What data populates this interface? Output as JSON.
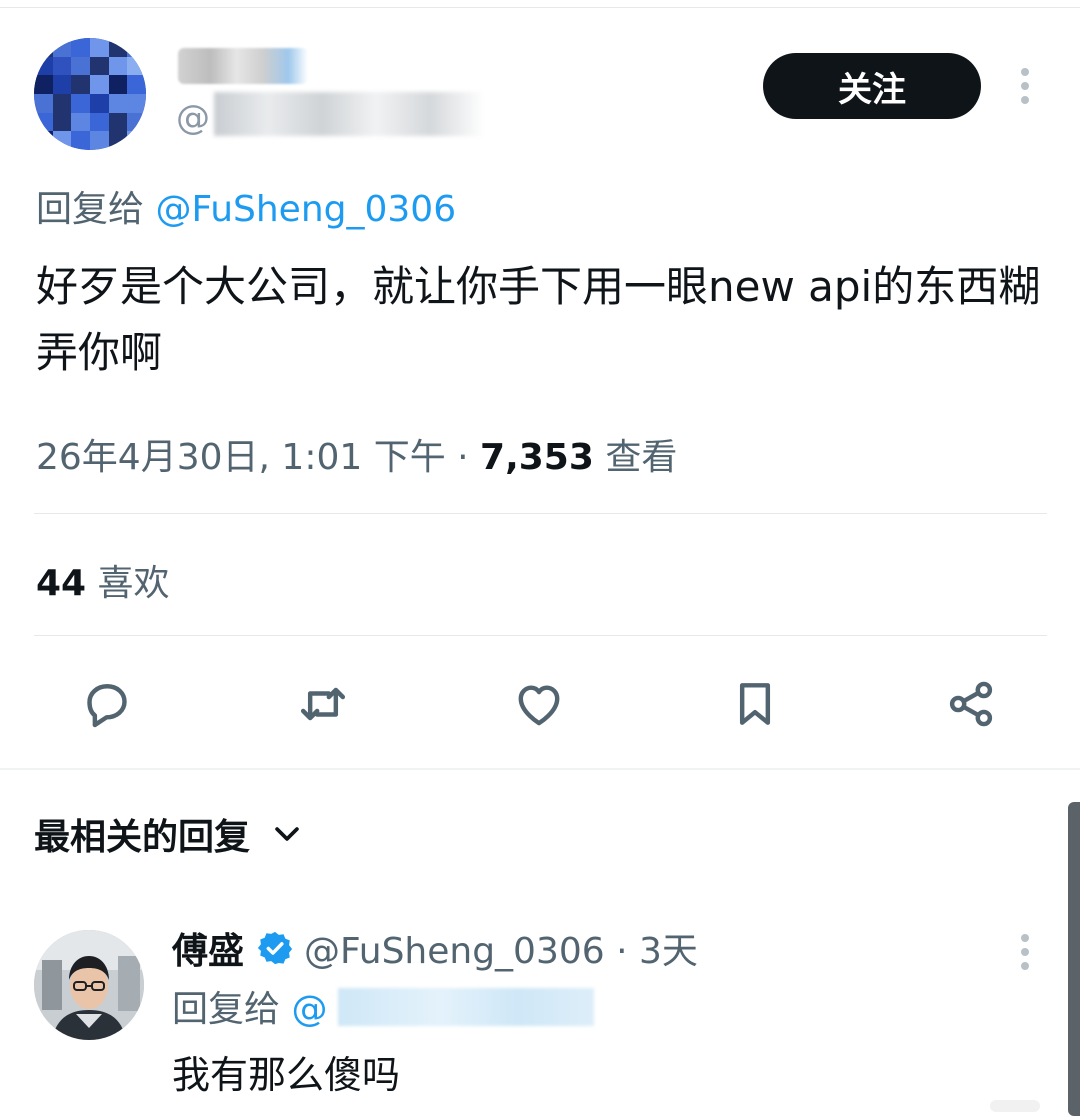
{
  "tweet": {
    "handle_at": "@",
    "follow_label": "关注",
    "reply_to_prefix": "回复给 ",
    "reply_to_handle": "@FuSheng_0306",
    "text": "好歹是个大公司，就让你手下用一眼new api的东西糊弄你啊",
    "timestamp": "26年4月30日, 1:01 下午 · ",
    "views_count": "7,353",
    "views_label": " 查看",
    "likes_count": "44",
    "likes_label": " 喜欢"
  },
  "actions": [
    {
      "name": "reply",
      "icon": "reply-icon"
    },
    {
      "name": "retweet",
      "icon": "retweet-icon"
    },
    {
      "name": "like",
      "icon": "heart-icon"
    },
    {
      "name": "bookmark",
      "icon": "bookmark-icon"
    },
    {
      "name": "share",
      "icon": "share-icon"
    }
  ],
  "replies_section": {
    "sort_label": "最相关的回复",
    "sort_icon": "chevron-down-icon"
  },
  "reply": {
    "name": "傅盛",
    "handle_time": "@FuSheng_0306 · 3天",
    "reply_to_prefix": "回复给 ",
    "reply_to_at": "@",
    "text": "我有那么傻吗"
  },
  "colors": {
    "text_primary": "#0f1419",
    "text_secondary": "#536471",
    "accent_blue": "#1d9bf0",
    "follow_button": "#0f1419",
    "divider": "#e6e9ec"
  }
}
